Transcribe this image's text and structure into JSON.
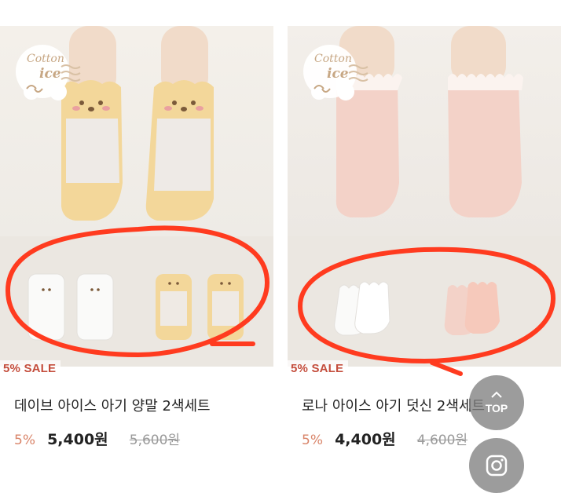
{
  "brand": {
    "line1": "Cotton",
    "line2": "ice"
  },
  "products": [
    {
      "badge": "5% SALE",
      "title": "데이브 아이스 아기 양말 2색세트",
      "discount": "5%",
      "price": "5,400원",
      "original_price": "5,600원"
    },
    {
      "badge": "5% SALE",
      "title": "로나 아이스 아기 덧신 2색세트",
      "discount": "5%",
      "price": "4,400원",
      "original_price": "4,600원"
    }
  ],
  "floating": {
    "top_label": "TOP",
    "top_icon": "chevron-up-icon",
    "instagram_icon": "instagram-icon"
  },
  "colors": {
    "sale_red": "#c44d3c",
    "discount": "#d98469",
    "annotation": "#ff3b1f"
  }
}
